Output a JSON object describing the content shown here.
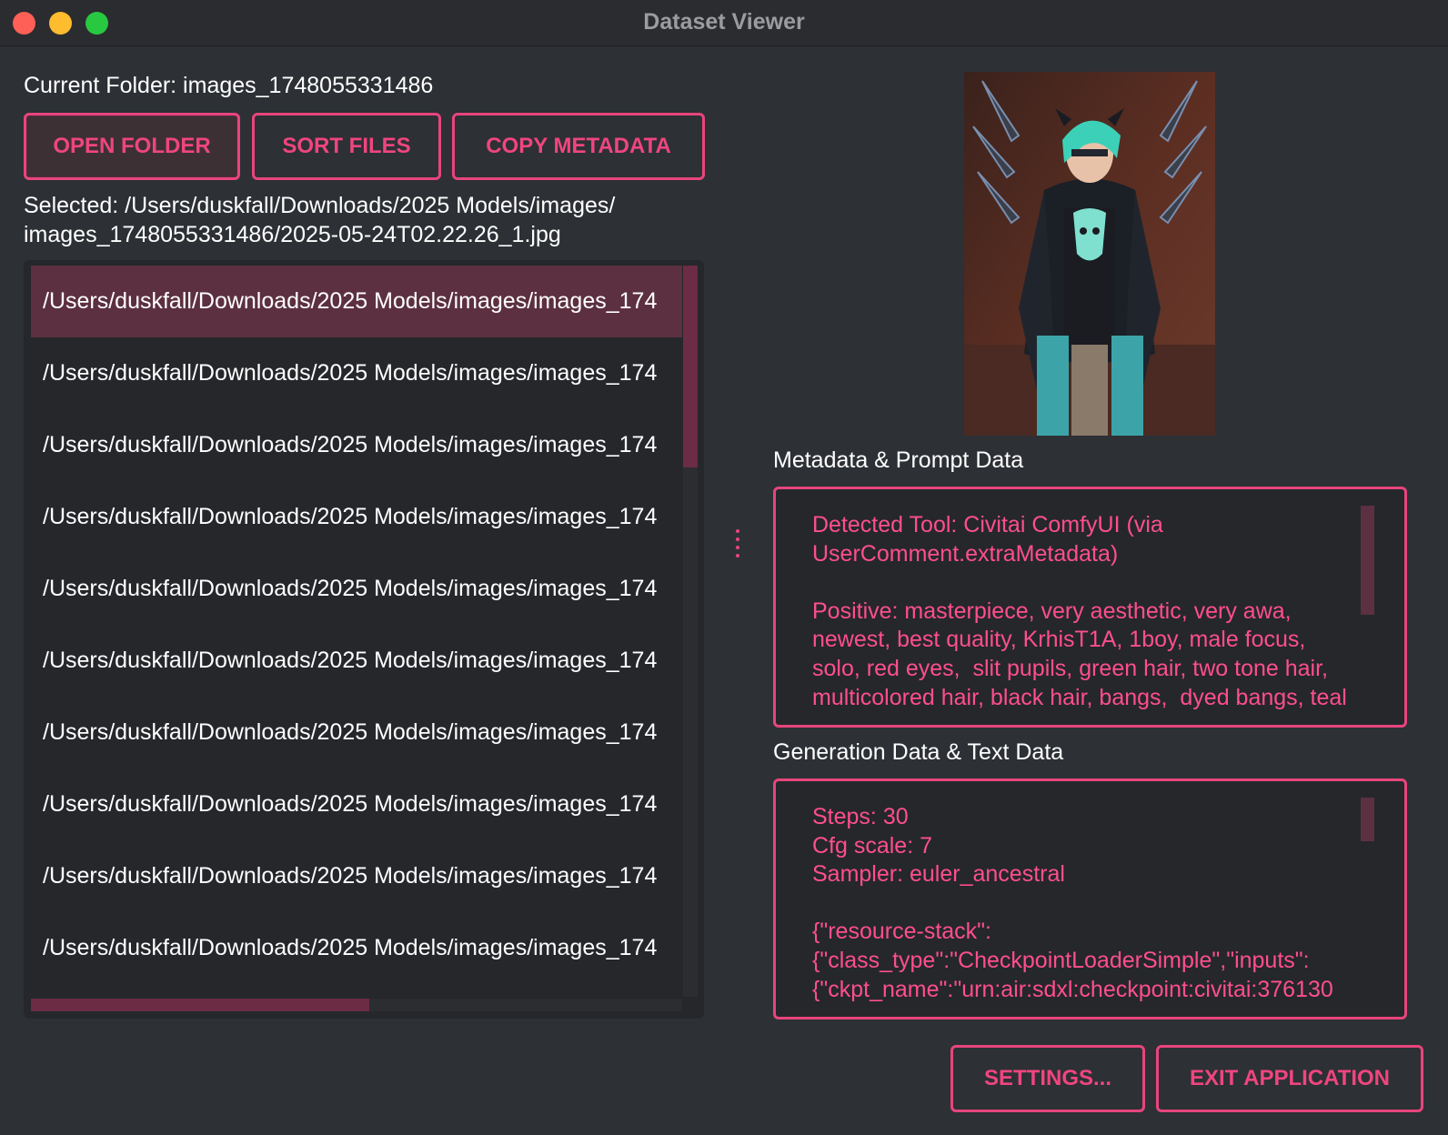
{
  "window": {
    "title": "Dataset Viewer"
  },
  "folder": {
    "label": "Current Folder: images_1748055331486"
  },
  "toolbar": {
    "open_folder": "OPEN FOLDER",
    "sort_files": "SORT FILES",
    "copy_metadata": "COPY METADATA"
  },
  "selected": {
    "label": "Selected: /Users/duskfall/Downloads/2025 Models/images/\nimages_1748055331486/2025-05-24T02.22.26_1.jpg"
  },
  "file_list": {
    "items": [
      "/Users/duskfall/Downloads/2025 Models/images/images_174",
      "/Users/duskfall/Downloads/2025 Models/images/images_174",
      "/Users/duskfall/Downloads/2025 Models/images/images_174",
      "/Users/duskfall/Downloads/2025 Models/images/images_174",
      "/Users/duskfall/Downloads/2025 Models/images/images_174",
      "/Users/duskfall/Downloads/2025 Models/images/images_174",
      "/Users/duskfall/Downloads/2025 Models/images/images_174",
      "/Users/duskfall/Downloads/2025 Models/images/images_174",
      "/Users/duskfall/Downloads/2025 Models/images/images_174",
      "/Users/duskfall/Downloads/2025 Models/images/images_174"
    ]
  },
  "metadata": {
    "label": "Metadata & Prompt Data",
    "text": "Detected Tool: Civitai ComfyUI (via\nUserComment.extraMetadata)\n\nPositive: masterpiece, very aesthetic, very awa,\nnewest, best quality, KrhisT1A, 1boy, male focus,\nsolo, red eyes,  slit pupils, green hair, two tone hair,\nmulticolored hair, black hair, bangs,  dyed bangs, teal"
  },
  "generation": {
    "label": "Generation Data & Text Data",
    "text": "Steps: 30\nCfg scale: 7\nSampler: euler_ancestral\n\n{\"resource-stack\":\n{\"class_type\":\"CheckpointLoaderSimple\",\"inputs\":\n{\"ckpt_name\":\"urn:air:sdxl:checkpoint:civitai:376130"
  },
  "footer": {
    "settings": "SETTINGS...",
    "exit": "EXIT APPLICATION"
  },
  "colors": {
    "accent": "#e8457c",
    "accent_text": "#ff4f8b",
    "background": "#2d3035",
    "panel": "#25272b",
    "selection": "#5c3040"
  }
}
